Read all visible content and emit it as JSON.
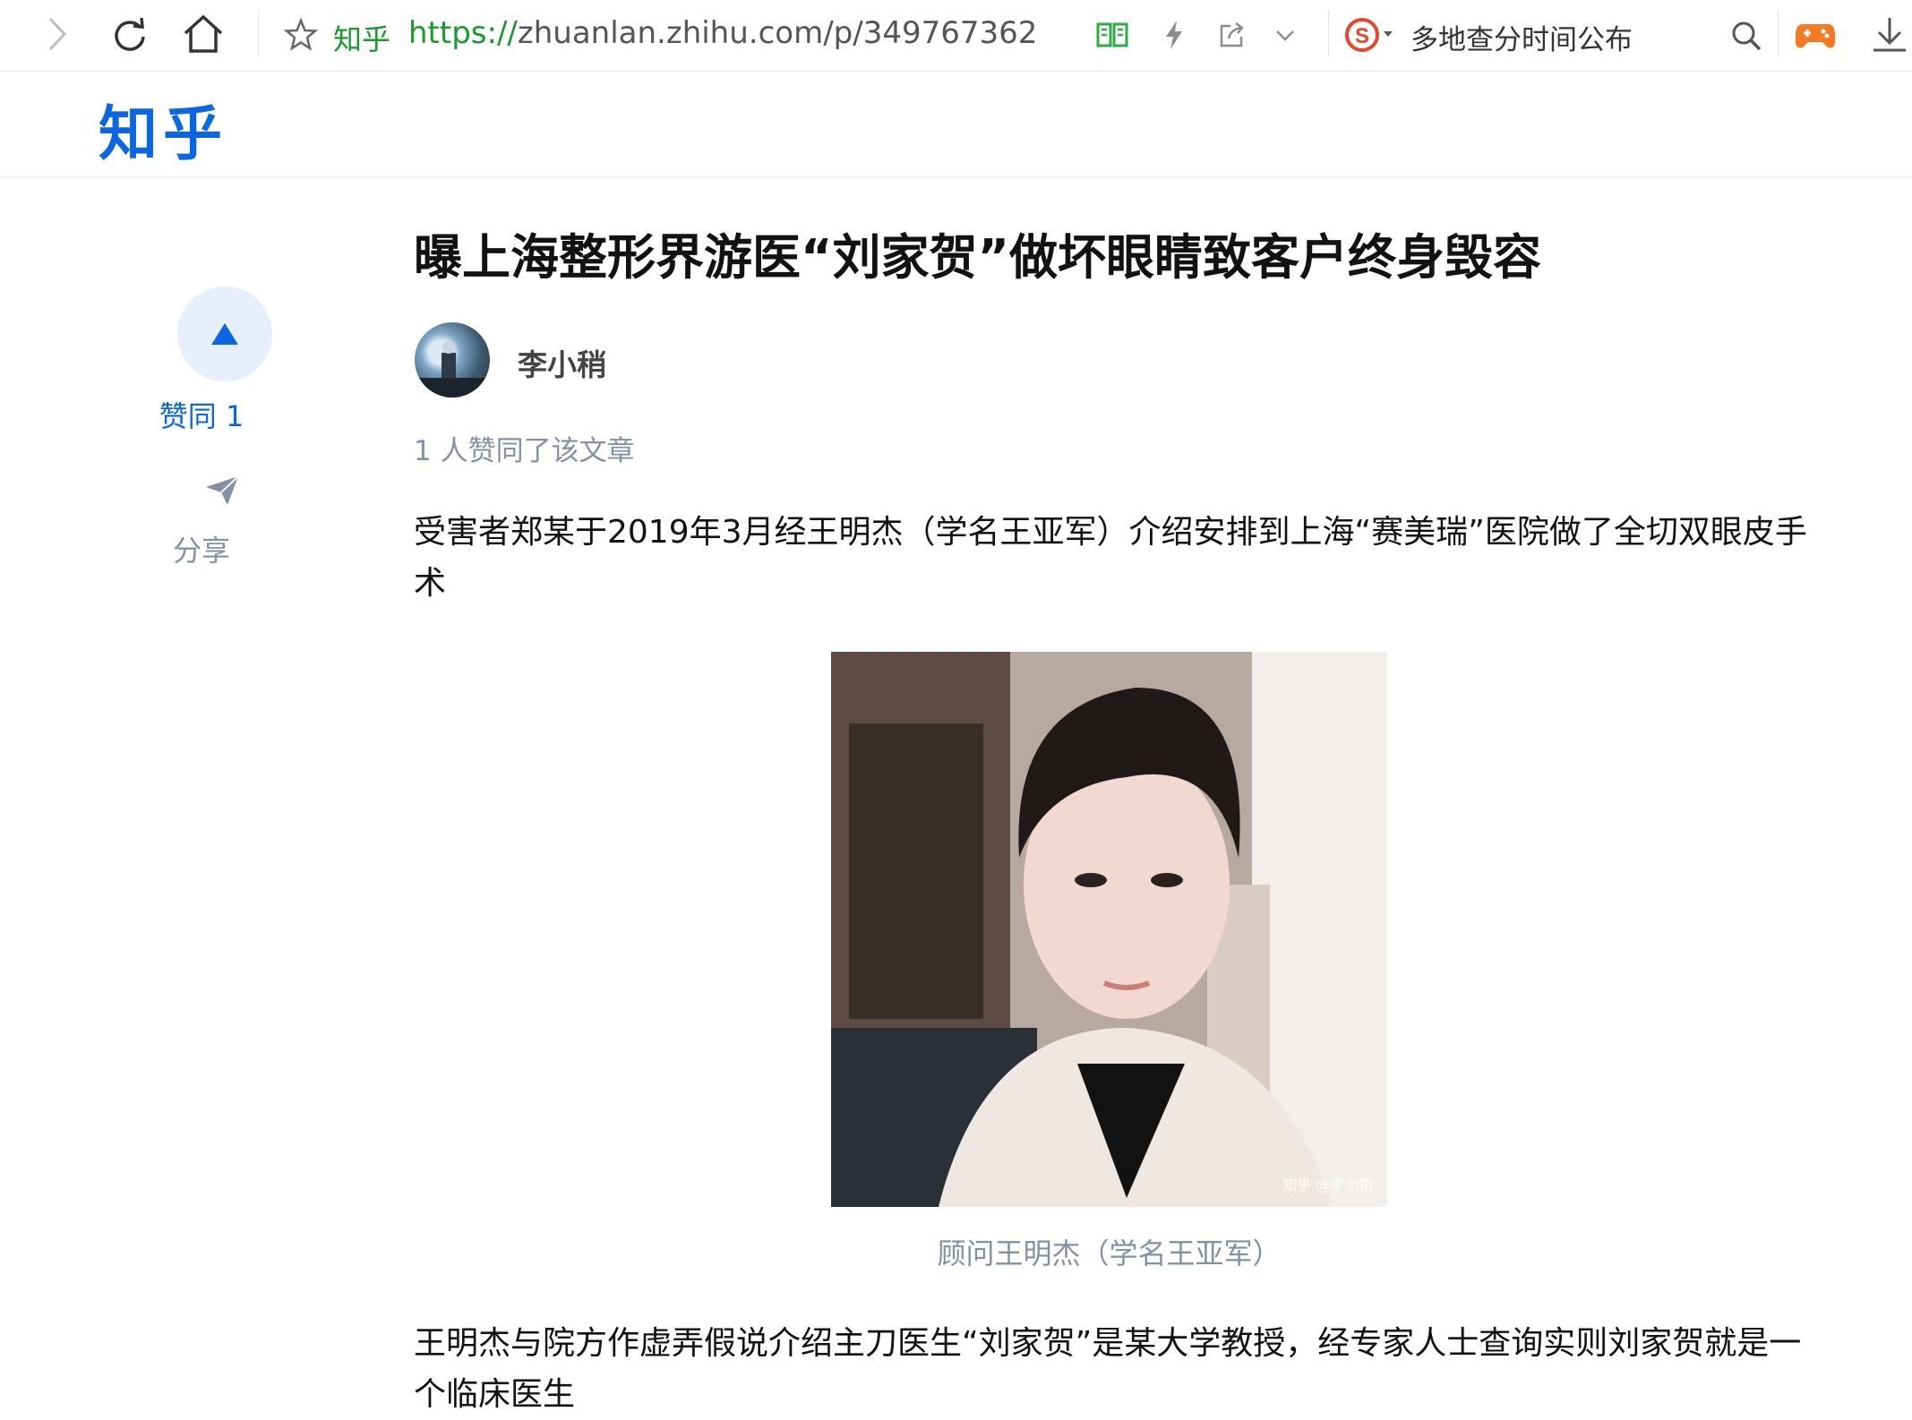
{
  "browser": {
    "site_name": "知乎",
    "url_scheme": "https://",
    "url_rest": "zhuanlan.zhihu.com/p/349767362",
    "search_text": "多地查分时间公布",
    "icons": [
      "forward-icon",
      "refresh-icon",
      "home-icon",
      "star-icon",
      "reader-icon",
      "lightning-icon",
      "share-icon",
      "chevron-down-icon",
      "sogou-icon",
      "search-icon",
      "game-icon",
      "download-icon"
    ]
  },
  "header": {
    "logo": "知乎"
  },
  "sidebar": {
    "vote_label": "赞同 1",
    "share_label": "分享"
  },
  "article": {
    "title": "曝上海整形界游医“刘家贺”做坏眼睛致客户终身毁容",
    "author": "李小稍",
    "votes_text": "1 人赞同了该文章",
    "paragraph1": "受害者郑某于2019年3月经王明杰（学名王亚军）介绍安排到上海“赛美瑞”医院做了全切双眼皮手术",
    "image_watermark": "知乎 @李小稍",
    "caption": "顾问王明杰（学名王亚军）",
    "paragraph2": "王明杰与院方作虚弄假说介绍主刀医生“刘家贺”是某大学教授，经专家人士查询实则刘家贺就是一个临床医生"
  },
  "colors": {
    "brand": "#0a66e3",
    "muted": "#8590a6",
    "url_green": "#1a9a2a"
  }
}
